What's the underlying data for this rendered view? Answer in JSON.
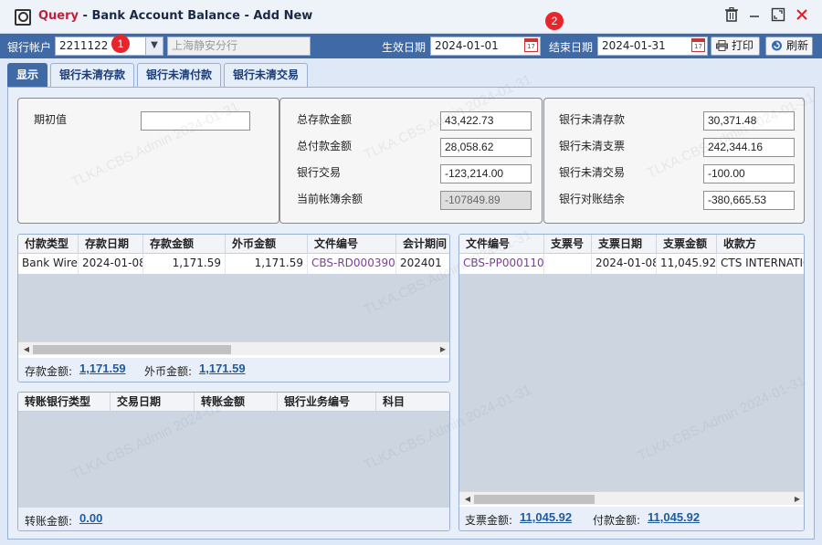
{
  "window": {
    "title_prefix": "Query",
    "title_separator": " - ",
    "title_rest": "Bank Account Balance - Add New"
  },
  "badges": [
    "1",
    "2"
  ],
  "toolbar": {
    "bank_account_label": "银行帐户",
    "bank_account_value": "2211122",
    "bank_name": "上海静安分行",
    "start_date_label": "生效日期",
    "start_date_value": "2024-01-01",
    "end_date_label": "结束日期",
    "end_date_value": "2024-01-31",
    "print_label": "打印",
    "refresh_label": "刷新",
    "calendar_day": "17"
  },
  "tabs": [
    "显示",
    "银行未清存款",
    "银行未清付款",
    "银行未清交易"
  ],
  "summary": {
    "opening_label": "期初值",
    "opening_value": "",
    "total_deposit_label": "总存款金额",
    "total_deposit_value": "43,422.73",
    "total_payment_label": "总付款金额",
    "total_payment_value": "28,058.62",
    "bank_txn_label": "银行交易",
    "bank_txn_value": "-123,214.00",
    "current_book_label": "当前帐簿余额",
    "current_book_value": "-107849.89",
    "uncleared_deposit_label": "银行未清存款",
    "uncleared_deposit_value": "30,371.48",
    "uncleared_check_label": "银行未清支票",
    "uncleared_check_value": "242,344.16",
    "uncleared_txn_label": "银行未清交易",
    "uncleared_txn_value": "-100.00",
    "reconcile_label": "银行对账结余",
    "reconcile_value": "-380,665.53"
  },
  "deposits": {
    "headers": [
      "付款类型",
      "存款日期",
      "存款金额",
      "外币金额",
      "文件编号",
      "会计期间"
    ],
    "rows": [
      [
        "Bank Wire",
        "2024-01-08",
        "1,171.59",
        "1,171.59",
        "CBS-RD000390",
        "202401"
      ]
    ],
    "footer_deposit_label": "存款金额:",
    "footer_deposit_value": "1,171.59",
    "footer_foreign_label": "外币金额:",
    "footer_foreign_value": "1,171.59"
  },
  "payments": {
    "headers": [
      "文件编号",
      "支票号",
      "支票日期",
      "支票金额",
      "收款方"
    ],
    "rows": [
      [
        "CBS-PP000110",
        "",
        "2024-01-08",
        "11,045.92",
        "CTS INTERNATIONAL"
      ]
    ],
    "footer_check_label": "支票金额:",
    "footer_check_value": "11,045.92",
    "footer_payment_label": "付款金额:",
    "footer_payment_value": "11,045.92"
  },
  "transfers": {
    "headers": [
      "转账银行类型",
      "交易日期",
      "转账金额",
      "银行业务编号",
      "科目"
    ],
    "footer_label": "转账金额:",
    "footer_value": "0.00"
  },
  "watermark_text": "TLKA.CBS.Admin 2024-01-31"
}
